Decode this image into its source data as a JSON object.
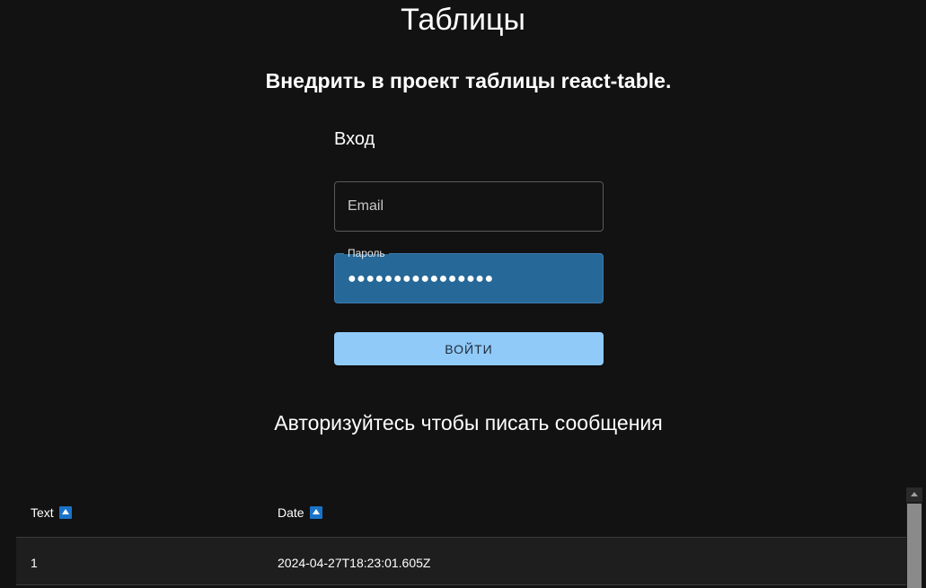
{
  "page": {
    "title": "Таблицы",
    "subtitle": "Внедрить в проект таблицы react-table."
  },
  "login": {
    "heading": "Вход",
    "email_placeholder": "Email",
    "email_value": "",
    "password_label": "Пароль",
    "password_value": "●●●●●●●●●●●●●●●●",
    "submit_label": "Войти"
  },
  "auth_message": "Авторизуйтесь чтобы писать сообщения",
  "table": {
    "columns": [
      {
        "label": "Text",
        "sort_icon": "sort-ascending-icon"
      },
      {
        "label": "Date",
        "sort_icon": "sort-ascending-icon"
      }
    ],
    "rows": [
      {
        "text": "1",
        "date": "2024-04-27T18:23:01.605Z"
      }
    ]
  },
  "colors": {
    "background": "#121212",
    "password_field": "#266897",
    "button": "#90caf9",
    "sort_icon": "#1a73c9"
  }
}
